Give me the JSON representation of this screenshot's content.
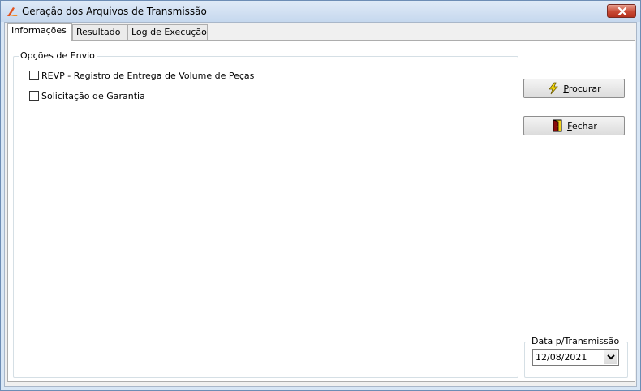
{
  "window": {
    "title": "Geração dos Arquivos de Transmissão",
    "close_icon": "close-icon"
  },
  "tabs": [
    {
      "label": "Informações",
      "active": true
    },
    {
      "label": "Resultado",
      "active": false
    },
    {
      "label": "Log de Execução",
      "active": false
    }
  ],
  "options_group": {
    "legend": "Opções de Envio",
    "checkboxes": [
      {
        "label": "REVP - Registro de Entrega de Volume de Peças",
        "checked": false
      },
      {
        "label": "Solicitação de Garantia",
        "checked": false
      }
    ]
  },
  "buttons": {
    "search": {
      "label_underlined": "P",
      "label_rest": "rocurar",
      "icon": "lightning-icon"
    },
    "close": {
      "label_underlined": "F",
      "label_rest": "echar",
      "icon": "exit-door-icon"
    }
  },
  "date_group": {
    "legend": "Data p/Transmissão",
    "value": "12/08/2021"
  }
}
